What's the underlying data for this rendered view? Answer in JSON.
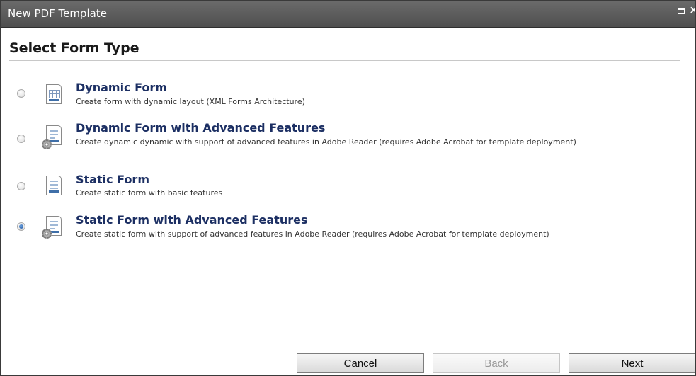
{
  "window": {
    "title": "New PDF Template",
    "maximize_icon": "maximize-icon",
    "close_icon": "close-icon",
    "close_glyph": "×"
  },
  "heading": "Select Form Type",
  "options": [
    {
      "title": "Dynamic Form",
      "description": "Create form with dynamic layout (XML Forms Architecture)",
      "selected": false,
      "icon": "dynamic-form-icon"
    },
    {
      "title": "Dynamic Form with Advanced Features",
      "description": "Create dynamic dynamic with support of advanced features in Adobe Reader (requires Adobe Acrobat for template deployment)",
      "selected": false,
      "icon": "dynamic-form-advanced-icon"
    },
    {
      "title": "Static Form",
      "description": "Create static form with basic features",
      "selected": false,
      "icon": "static-form-icon"
    },
    {
      "title": "Static Form with Advanced Features",
      "description": "Create static form with support of advanced features in Adobe Reader (requires Adobe Acrobat for template deployment)",
      "selected": true,
      "icon": "static-form-advanced-icon"
    }
  ],
  "buttons": {
    "cancel": "Cancel",
    "back": "Back",
    "next": "Next"
  },
  "colors": {
    "titlebar": "#5a5a5a",
    "option_title": "#1c2f63",
    "selected_radio": "#1d4f9c"
  }
}
